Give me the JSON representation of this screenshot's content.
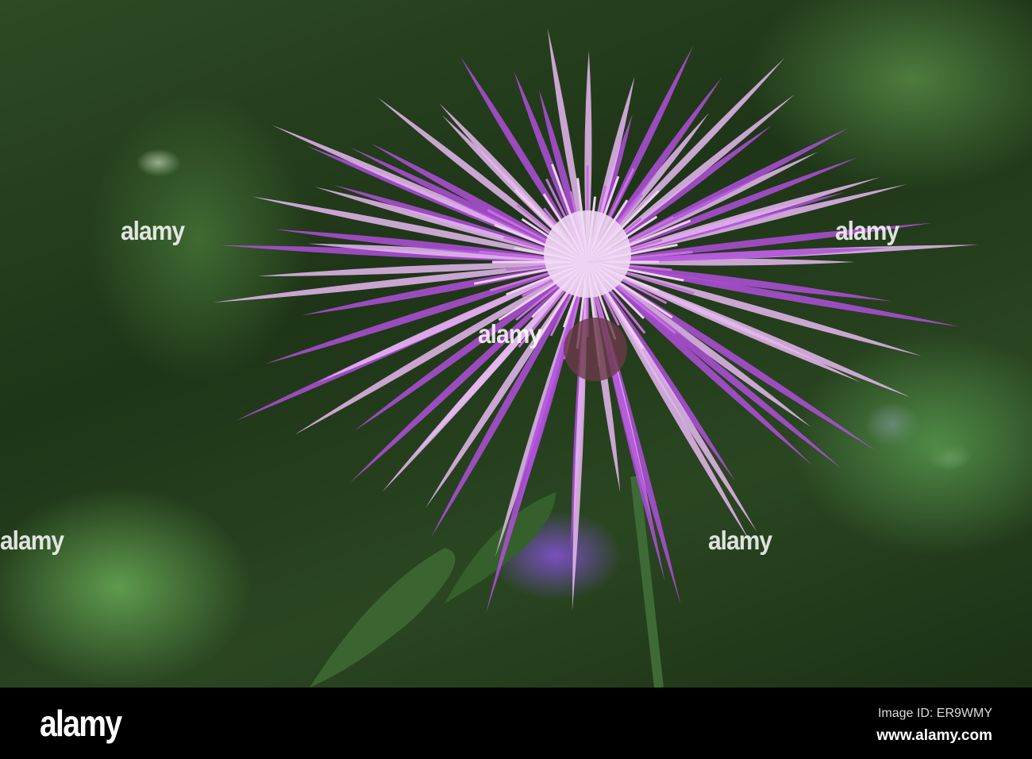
{
  "photo": {
    "subject": "pink-purple knapweed flower",
    "colors": {
      "petal": "#b04fdc",
      "petal_light": "#e8b8f2",
      "center": "#f4e6f6",
      "leaf": "#3d6a34"
    }
  },
  "watermark": {
    "text": "alamy"
  },
  "footer": {
    "logo": "alamy",
    "image_id": "Image ID: ER9WMY",
    "url": "www.alamy.com"
  }
}
